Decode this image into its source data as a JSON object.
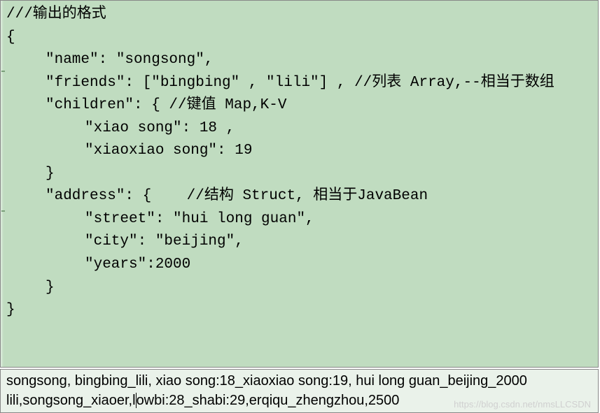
{
  "code": {
    "l1": "///输出的格式",
    "l2": "{",
    "l3": "\"name\": \"songsong\",",
    "l4": "\"friends\": [\"bingbing\" , \"lili\"] , //列表 Array,--相当于数组",
    "l5": "",
    "l6": "\"children\": { //键值 Map,K-V",
    "l7": "\"xiao song\": 18 ,",
    "l8": "\"xiaoxiao song\": 19",
    "l9": "}",
    "l10": "",
    "l11": "\"address\": {    //结构 Struct, 相当于JavaBean",
    "l12": "\"street\": \"hui long guan\",",
    "l13": "\"city\": \"beijing\",",
    "l14": "\"years\":2000",
    "l15": "}",
    "l16": "}"
  },
  "bottom": {
    "line1": "songsong, bingbing_lili, xiao song:18_xiaoxiao song:19, hui long guan_beijing_2000",
    "line2a": "lili,songsong_xiaoer,l",
    "line2b": "owbi:28_shabi:29,erqiqu_zhengzhou,2500"
  },
  "watermark": "https://blog.csdn.net/nmsLLCSDN"
}
